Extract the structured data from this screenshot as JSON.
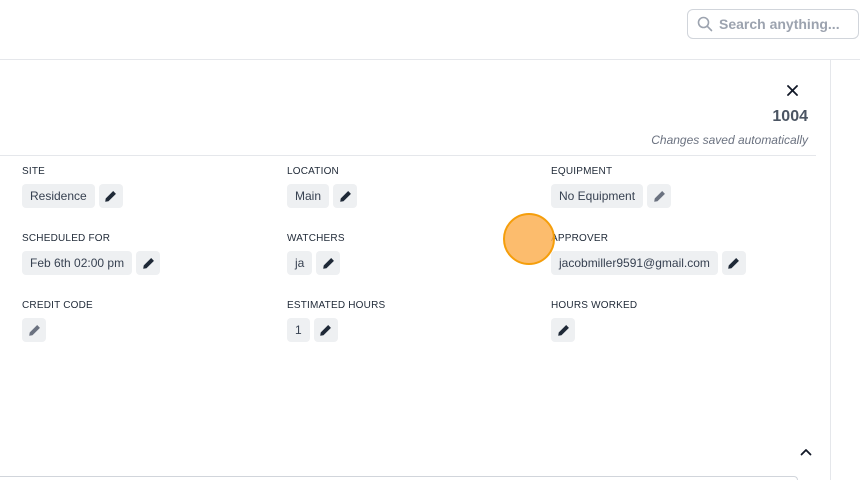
{
  "search": {
    "placeholder": "Search anything..."
  },
  "record": {
    "id": "1004",
    "save_status": "Changes saved automatically"
  },
  "fields": [
    {
      "label": "SITE",
      "value": "Residence"
    },
    {
      "label": "LOCATION",
      "value": "Main"
    },
    {
      "label": "EQUIPMENT",
      "value": "No Equipment"
    },
    {
      "label": "SCHEDULED FOR",
      "value": "Feb 6th 02:00 pm"
    },
    {
      "label": "WATCHERS",
      "value": "ja"
    },
    {
      "label": "APPROVER",
      "value": "jacobmiller9591@gmail.com"
    },
    {
      "label": "CREDIT CODE",
      "value": ""
    },
    {
      "label": "ESTIMATED HOURS",
      "value": "1"
    },
    {
      "label": "HOURS WORKED",
      "value": ""
    }
  ],
  "icons": {
    "search": "search-icon",
    "close": "close-icon",
    "edit": "pencil-icon",
    "collapse": "chevron-up-icon"
  },
  "colors": {
    "chip_bg": "#eef0f2",
    "cursor": "#fbb054"
  }
}
